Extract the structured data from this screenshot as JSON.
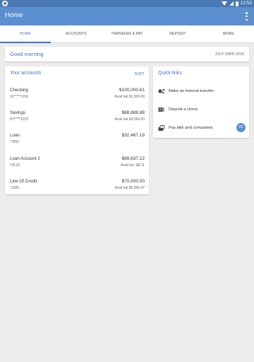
{
  "status_bar": {
    "time": "12:53"
  },
  "appbar": {
    "title": "Home"
  },
  "tabs": [
    {
      "label": "HOME",
      "active": true
    },
    {
      "label": "ACCOUNTS",
      "active": false
    },
    {
      "label": "TRANSFER & PAY",
      "active": false
    },
    {
      "label": "DEPOSIT",
      "active": false
    },
    {
      "label": "MORE",
      "active": false
    }
  ],
  "greeting": {
    "text": "Good morning",
    "date": "JULY 03RD 2019"
  },
  "accounts": {
    "title": "Your accounts",
    "sort_label": "SORT",
    "items": [
      {
        "name": "Checking",
        "number": "91*****1156",
        "balance": "$100,000.61",
        "available": "Avail bal $1,500.00"
      },
      {
        "name": "Savings",
        "number": "81*****2222",
        "balance": "$88,888.88",
        "available": "Avail bal $3,566.00"
      },
      {
        "name": "Loan",
        "number": "*7892",
        "balance": "$32,467.19",
        "available": ""
      },
      {
        "name": "Loan Account 2",
        "number": "*05.01",
        "balance": "$99,837.22",
        "available": "Avail bal -$9.11"
      },
      {
        "name": "Line Of Credit",
        "number": "*1000",
        "balance": "$70,000.00",
        "available": "Avail bal $5,900.47"
      }
    ]
  },
  "quick_links": {
    "title": "Quick links",
    "items": [
      {
        "label": "Make an internal transfer",
        "icon": "transfer-icon"
      },
      {
        "label": "Deposit a check",
        "icon": "check-deposit-icon"
      },
      {
        "label": "Pay bills and companies",
        "icon": "bill-pay-icon",
        "badge": "02"
      }
    ]
  },
  "colors": {
    "primary": "#5b8fd0",
    "statusbar": "#4a78b3",
    "accent": "#3b73c4",
    "background": "#ececec"
  }
}
